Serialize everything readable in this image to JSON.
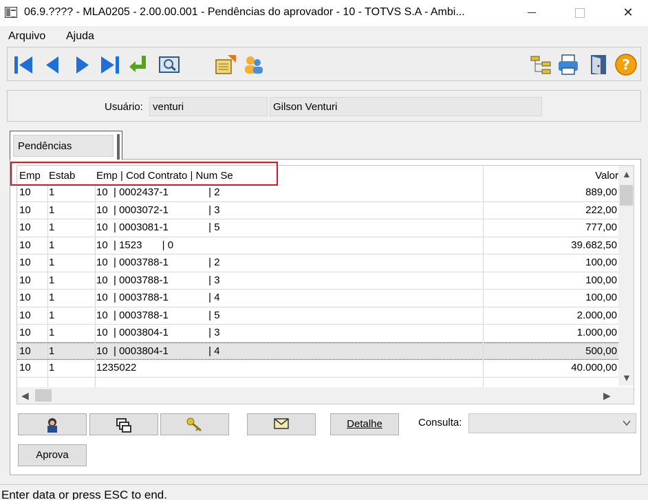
{
  "window": {
    "title": "06.9.???? - MLA0205 - 2.00.00.001 - Pendências do aprovador - 10 - TOTVS S.A - Ambi...",
    "close_glyph": "✕"
  },
  "menu": {
    "items": [
      "Arquivo",
      "Ajuda"
    ]
  },
  "header": {
    "user_label": "Usuário:",
    "user_code": "venturi",
    "user_name": "Gilson Venturi"
  },
  "tab": {
    "label": "Pendências"
  },
  "grid": {
    "headers": {
      "emp": "Emp",
      "estab": "Estab",
      "doc": "Emp | Cod Contrato | Num Se",
      "valor": "Valor"
    },
    "rows": [
      {
        "emp": "10",
        "estab": "1",
        "doc": "10  | 0002437-1              | 2",
        "valor": "889,00"
      },
      {
        "emp": "10",
        "estab": "1",
        "doc": "10  | 0003072-1              | 3",
        "valor": "222,00"
      },
      {
        "emp": "10",
        "estab": "1",
        "doc": "10  | 0003081-1              | 5",
        "valor": "777,00"
      },
      {
        "emp": "10",
        "estab": "1",
        "doc": "10  | 1523       | 0",
        "valor": "39.682,50"
      },
      {
        "emp": "10",
        "estab": "1",
        "doc": "10  | 0003788-1              | 2",
        "valor": "100,00"
      },
      {
        "emp": "10",
        "estab": "1",
        "doc": "10  | 0003788-1              | 3",
        "valor": "100,00"
      },
      {
        "emp": "10",
        "estab": "1",
        "doc": "10  | 0003788-1              | 4",
        "valor": "100,00"
      },
      {
        "emp": "10",
        "estab": "1",
        "doc": "10  | 0003788-1              | 5",
        "valor": "2.000,00"
      },
      {
        "emp": "10",
        "estab": "1",
        "doc": "10  | 0003804-1              | 3",
        "valor": "1.000,00"
      },
      {
        "emp": "10",
        "estab": "1",
        "doc": "10  | 0003804-1              | 4",
        "valor": "500,00"
      },
      {
        "emp": "10",
        "estab": "1",
        "doc": "1235022",
        "valor": "40.000,00"
      }
    ],
    "selected_row": 9
  },
  "buttons": {
    "detalhe": "Detalhe",
    "aprova": "Aprova",
    "consulta_label": "Consulta:",
    "consulta_value": ""
  },
  "status": {
    "text": "Enter data or press ESC to end."
  },
  "colors": {
    "highlight": "#e0141c",
    "icon_blue": "#1f6fd6"
  }
}
